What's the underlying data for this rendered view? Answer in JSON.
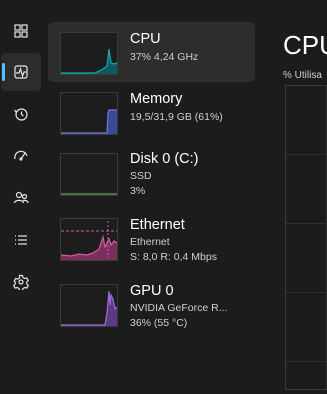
{
  "nav": {
    "items": [
      {
        "icon": "processes-icon"
      },
      {
        "icon": "performance-icon",
        "active": true
      },
      {
        "icon": "app-history-icon"
      },
      {
        "icon": "startup-apps-icon"
      },
      {
        "icon": "users-icon"
      },
      {
        "icon": "details-icon"
      },
      {
        "icon": "services-icon"
      }
    ]
  },
  "devices": [
    {
      "title": "CPU",
      "lines": [
        "37%  4,24 GHz"
      ],
      "color": "#17a8b6",
      "fill": "#0f5a62"
    },
    {
      "title": "Memory",
      "lines": [
        "19,5/31,9 GB (61%)"
      ],
      "color": "#6b7bd6",
      "fill": "#3b4a99"
    },
    {
      "title": "Disk 0 (C:)",
      "lines": [
        "SSD",
        "3%"
      ],
      "color": "#58a84b",
      "fill": "#2c4f27"
    },
    {
      "title": "Ethernet",
      "lines": [
        "Ethernet",
        "S: 8,0  R: 0,4 Mbps"
      ],
      "color": "#d05fa2",
      "fill": "#7a2f5d"
    },
    {
      "title": "GPU 0",
      "lines": [
        "NVIDIA GeForce R...",
        "36%  (55 °C)"
      ],
      "color": "#a16bd8",
      "fill": "#5a3a84"
    }
  ],
  "main": {
    "title": "CPU",
    "label": "% Utilisa"
  },
  "colors": {
    "background": "#1c1c1c",
    "selected": "#2d2d2d",
    "accent": "#4cc2ff"
  }
}
